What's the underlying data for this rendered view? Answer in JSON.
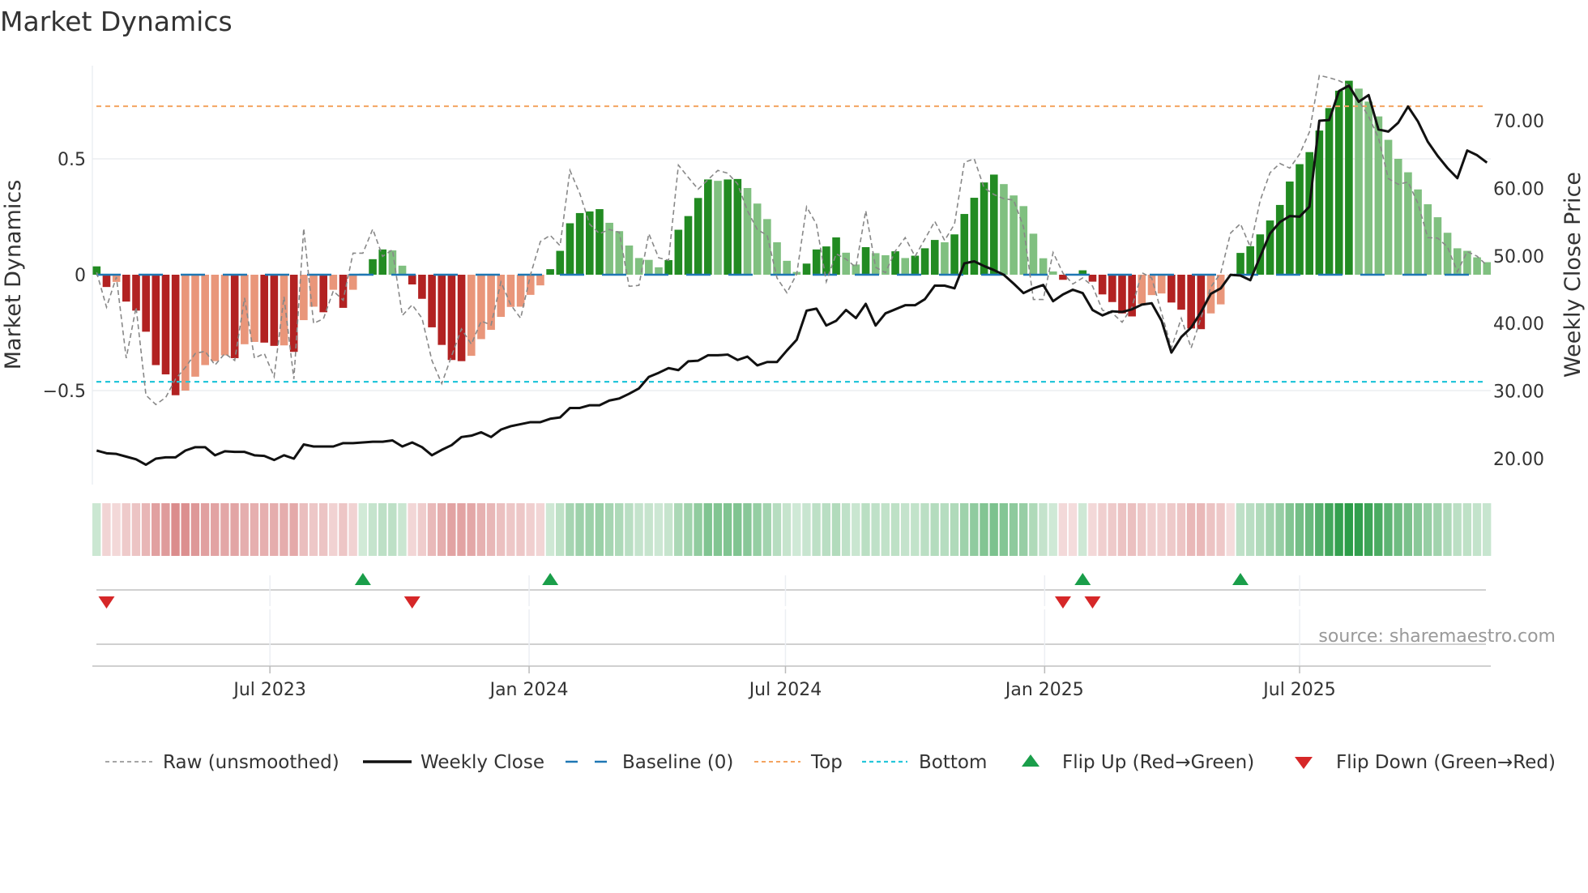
{
  "chart_data": {
    "type": "bar",
    "title": "Market Dynamics",
    "ylabel": "Market Dynamics",
    "y2label": "Weekly Close Price",
    "ylim": [
      -0.906,
      0.9
    ],
    "y2lim": [
      16.2,
      78.2
    ],
    "yticks": [
      {
        "v": 0.5,
        "label": "0.5"
      },
      {
        "v": 0,
        "label": "0"
      },
      {
        "v": -0.5,
        "label": "−0.5"
      }
    ],
    "y2ticks": [
      {
        "v": 70,
        "label": "70.00"
      },
      {
        "v": 60,
        "label": "60.00"
      },
      {
        "v": 50,
        "label": "50.00"
      },
      {
        "v": 40,
        "label": "40.00"
      },
      {
        "v": 30,
        "label": "30.00"
      },
      {
        "v": 20,
        "label": "20.00"
      }
    ],
    "x_start": "2023-02-28",
    "x_step_days": 7,
    "xticks": [
      {
        "date": "2023-07-01",
        "label": "Jul 2023"
      },
      {
        "date": "2024-01-01",
        "label": "Jan 2024"
      },
      {
        "date": "2024-07-01",
        "label": "Jul 2024"
      },
      {
        "date": "2025-01-01",
        "label": "Jan 2025"
      },
      {
        "date": "2025-07-01",
        "label": "Jul 2025"
      }
    ],
    "top_level": 0.727,
    "bottom_level": -0.462,
    "baseline": 0,
    "values": [
      0.036,
      -0.053,
      -0.031,
      -0.116,
      -0.155,
      -0.246,
      -0.39,
      -0.43,
      -0.52,
      -0.5,
      -0.44,
      -0.39,
      -0.373,
      -0.348,
      -0.36,
      -0.3,
      -0.29,
      -0.293,
      -0.307,
      -0.305,
      -0.333,
      -0.196,
      -0.138,
      -0.162,
      -0.065,
      -0.143,
      -0.065,
      0.004,
      0.067,
      0.109,
      0.105,
      0.039,
      -0.042,
      -0.104,
      -0.227,
      -0.303,
      -0.368,
      -0.373,
      -0.35,
      -0.278,
      -0.238,
      -0.182,
      -0.139,
      -0.138,
      -0.087,
      -0.046,
      0.024,
      0.103,
      0.222,
      0.266,
      0.273,
      0.283,
      0.224,
      0.188,
      0.126,
      0.072,
      0.064,
      0.032,
      0.063,
      0.194,
      0.253,
      0.331,
      0.411,
      0.405,
      0.411,
      0.413,
      0.374,
      0.307,
      0.24,
      0.14,
      0.06,
      0.012,
      0.048,
      0.109,
      0.122,
      0.161,
      0.095,
      0.044,
      0.119,
      0.093,
      0.084,
      0.101,
      0.072,
      0.082,
      0.114,
      0.15,
      0.14,
      0.174,
      0.262,
      0.332,
      0.398,
      0.432,
      0.391,
      0.342,
      0.296,
      0.177,
      0.071,
      0.014,
      -0.022,
      -0.003,
      0.019,
      -0.03,
      -0.085,
      -0.118,
      -0.167,
      -0.18,
      -0.126,
      -0.088,
      -0.081,
      -0.12,
      -0.151,
      -0.232,
      -0.235,
      -0.167,
      -0.128,
      -0.002,
      0.094,
      0.123,
      0.174,
      0.234,
      0.301,
      0.402,
      0.477,
      0.529,
      0.622,
      0.719,
      0.794,
      0.837,
      0.803,
      0.747,
      0.683,
      0.582,
      0.5,
      0.442,
      0.368,
      0.304,
      0.248,
      0.181,
      0.114,
      0.103,
      0.075,
      0.054
    ],
    "raw": [
      0.01,
      -0.14,
      -0.01,
      -0.36,
      -0.14,
      -0.52,
      -0.56,
      -0.53,
      -0.45,
      -0.4,
      -0.34,
      -0.33,
      -0.39,
      -0.34,
      -0.37,
      -0.1,
      -0.36,
      -0.34,
      -0.44,
      -0.095,
      -0.45,
      0.2,
      -0.21,
      -0.19,
      -0.07,
      -0.11,
      0.093,
      0.093,
      0.197,
      0.079,
      0.108,
      -0.176,
      -0.13,
      -0.188,
      -0.37,
      -0.47,
      -0.35,
      -0.234,
      -0.3,
      -0.2,
      -0.217,
      -0.031,
      -0.13,
      -0.188,
      0,
      0.143,
      0.17,
      0.125,
      0.45,
      0.35,
      0.218,
      0.177,
      0.195,
      0.183,
      -0.05,
      -0.046,
      0.177,
      0.073,
      0.062,
      0.473,
      0.42,
      0.369,
      0.41,
      0.45,
      0.438,
      0.392,
      0.276,
      0.195,
      0.17,
      -0.014,
      -0.078,
      0.003,
      0.293,
      0.218,
      -0.03,
      0.09,
      0.067,
      0.032,
      0.276,
      0.032,
      0.009,
      0.102,
      0.16,
      0.079,
      0.154,
      0.23,
      0.148,
      0.218,
      0.485,
      0.5,
      0.375,
      0.346,
      0.328,
      0.322,
      0.206,
      -0.107,
      -0.107,
      0.096,
      0.007,
      -0.04,
      -0.014,
      -0.049,
      -0.153,
      -0.165,
      -0.205,
      -0.14,
      0.009,
      -0.014,
      -0.165,
      -0.316,
      -0.188,
      -0.316,
      -0.187,
      -0.053,
      0.007,
      0.18,
      0.22,
      0.12,
      0.32,
      0.44,
      0.48,
      0.46,
      0.52,
      0.616,
      0.86,
      0.85,
      0.837,
      0.817,
      0.75,
      0.683,
      0.59,
      0.415,
      0.39,
      0.4,
      0.308,
      0.16,
      0.158,
      0.12,
      0.013,
      0.1,
      0.08,
      0.04
    ],
    "close": [
      21.2,
      20.8,
      20.7,
      20.3,
      19.9,
      19.1,
      20.0,
      20.2,
      20.2,
      21.2,
      21.7,
      21.7,
      20.5,
      21.1,
      21.0,
      21.0,
      20.5,
      20.4,
      19.8,
      20.5,
      20.0,
      22.1,
      21.8,
      21.8,
      21.8,
      22.3,
      22.3,
      22.4,
      22.5,
      22.5,
      22.7,
      21.8,
      22.4,
      21.7,
      20.5,
      21.3,
      22.0,
      23.2,
      23.4,
      23.9,
      23.2,
      24.3,
      24.8,
      25.1,
      25.4,
      25.4,
      25.9,
      26.1,
      27.5,
      27.5,
      27.9,
      27.9,
      28.6,
      28.9,
      29.6,
      30.4,
      32.1,
      32.7,
      33.4,
      33.1,
      34.4,
      34.5,
      35.3,
      35.3,
      35.4,
      34.6,
      35.1,
      33.8,
      34.3,
      34.3,
      36.0,
      37.6,
      41.9,
      42.2,
      39.7,
      40.4,
      42.0,
      40.8,
      42.9,
      39.7,
      41.5,
      42.1,
      42.7,
      42.7,
      43.6,
      45.6,
      45.6,
      45.2,
      48.9,
      49.2,
      48.5,
      47.9,
      47.2,
      45.9,
      44.5,
      45.2,
      45.7,
      43.3,
      44.3,
      45.0,
      44.5,
      42.0,
      41.2,
      41.8,
      41.7,
      42.1,
      42.8,
      43.0,
      40.4,
      35.7,
      38.0,
      39.4,
      41.7,
      44.4,
      45.2,
      47.2,
      47.1,
      46.4,
      49.9,
      53.3,
      55.0,
      55.9,
      55.8,
      57.3,
      70.0,
      70.1,
      74.4,
      75.2,
      72.8,
      73.8,
      68.7,
      68.4,
      69.7,
      72.1,
      69.9,
      66.9,
      64.8,
      63.0,
      61.5,
      65.6,
      64.9,
      63.8
    ],
    "flip_up_weeks": [
      27,
      46,
      100,
      116
    ],
    "flip_down_weeks": [
      1,
      32,
      98,
      101
    ],
    "legend": {
      "placement": "bottom",
      "raw": "Raw (unsmoothed)",
      "close": "Weekly Close",
      "baseline": "Baseline (0)",
      "top": "Top",
      "bottom": "Bottom",
      "flip_up": "Flip Up (Red→Green)",
      "flip_down": "Flip Down (Green→Red)"
    },
    "source": "source: sharemaestro.com",
    "colors": {
      "up_strong": "#228b22",
      "up_fade": "#80c080",
      "down_strong": "#b22222",
      "down_fade": "#e9967a",
      "raw": "#888888",
      "close": "#111111",
      "baseline": "#1f77b4",
      "top": "#f4a460",
      "bottom": "#26c6da",
      "flip_up": "#1a9e4a",
      "flip_down": "#d62728"
    }
  }
}
